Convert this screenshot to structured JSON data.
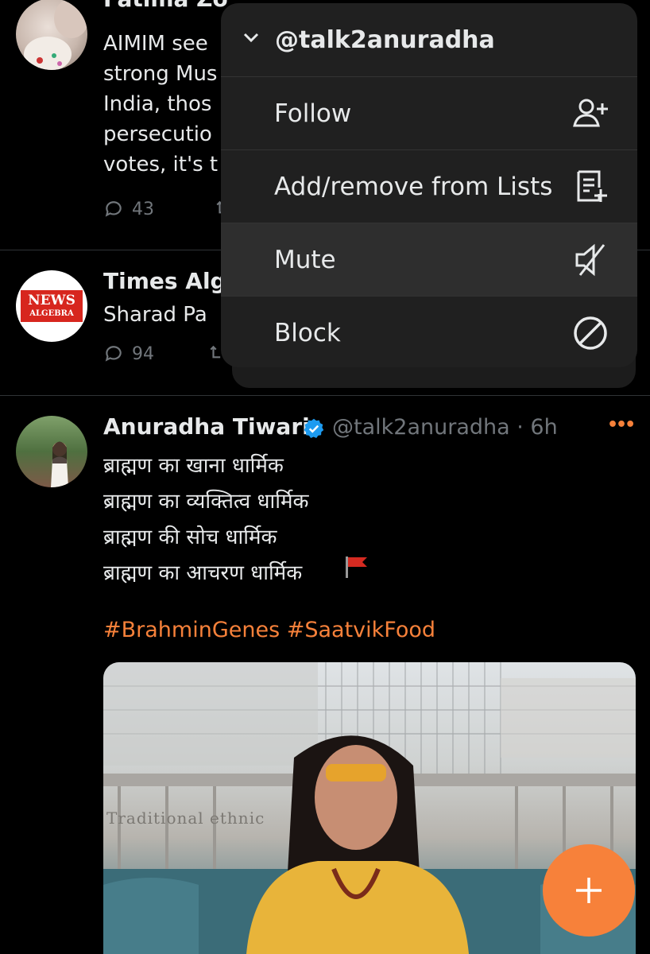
{
  "tweets": [
    {
      "name": "Fatima Zo",
      "body": "AIMIM see\nstrong Mus\nIndia, thos\npersecutio\nvotes, it's t",
      "replies": "43"
    },
    {
      "name": "Times Alg",
      "body": "Sharad Pa",
      "replies": "94",
      "avatar_text_top": "NEWS",
      "avatar_text_bottom": "ALGEBRA"
    },
    {
      "name": "Anuradha Tiwari",
      "handle": "@talk2anuradha",
      "time": "6h",
      "body": "ब्राह्मण का खाना धार्मिक\nब्राह्मण का व्यक्तित्व धार्मिक\nब्राह्मण की सोच धार्मिक\nब्राह्मण का आचरण धार्मिक",
      "hashtags": "#BrahminGenes #SaatvikFood",
      "more": "•••",
      "image_caption": "Traditional ethnic"
    }
  ],
  "menu": {
    "title": "@talk2anuradha",
    "items": [
      {
        "label": "Follow",
        "icon": "follow-icon"
      },
      {
        "label": "Add/remove from Lists",
        "icon": "list-add-icon"
      },
      {
        "label": "Mute",
        "icon": "mute-icon"
      },
      {
        "label": "Block",
        "icon": "block-icon"
      }
    ]
  },
  "colors": {
    "accent": "#f7813a",
    "verified": "#1d9bf0",
    "background": "#000000"
  }
}
